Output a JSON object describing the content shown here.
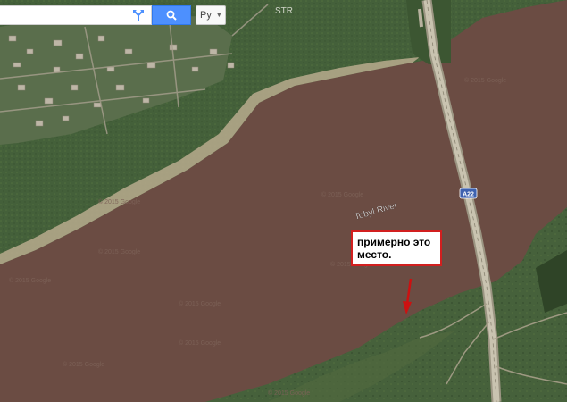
{
  "search": {
    "value": "",
    "placeholder": ""
  },
  "language_button": {
    "label": "Ру"
  },
  "map_labels": {
    "river": "Tobyl River",
    "road_shield": "A22",
    "village_label": "STR",
    "copyright": "© 2015 Google"
  },
  "annotation": {
    "line1": "примерно это",
    "line2": "место."
  },
  "icons": {
    "directions": "directions-icon",
    "search": "search-icon",
    "arrow": "red-arrow-icon",
    "caret": "caret-down-icon"
  },
  "colors": {
    "river": "#6b4c43",
    "land": "#3f5a36",
    "road": "#c9c3b0",
    "search_button": "#4d90fe",
    "annotation_border": "#d21f1f",
    "arrow": "#cc1111"
  }
}
